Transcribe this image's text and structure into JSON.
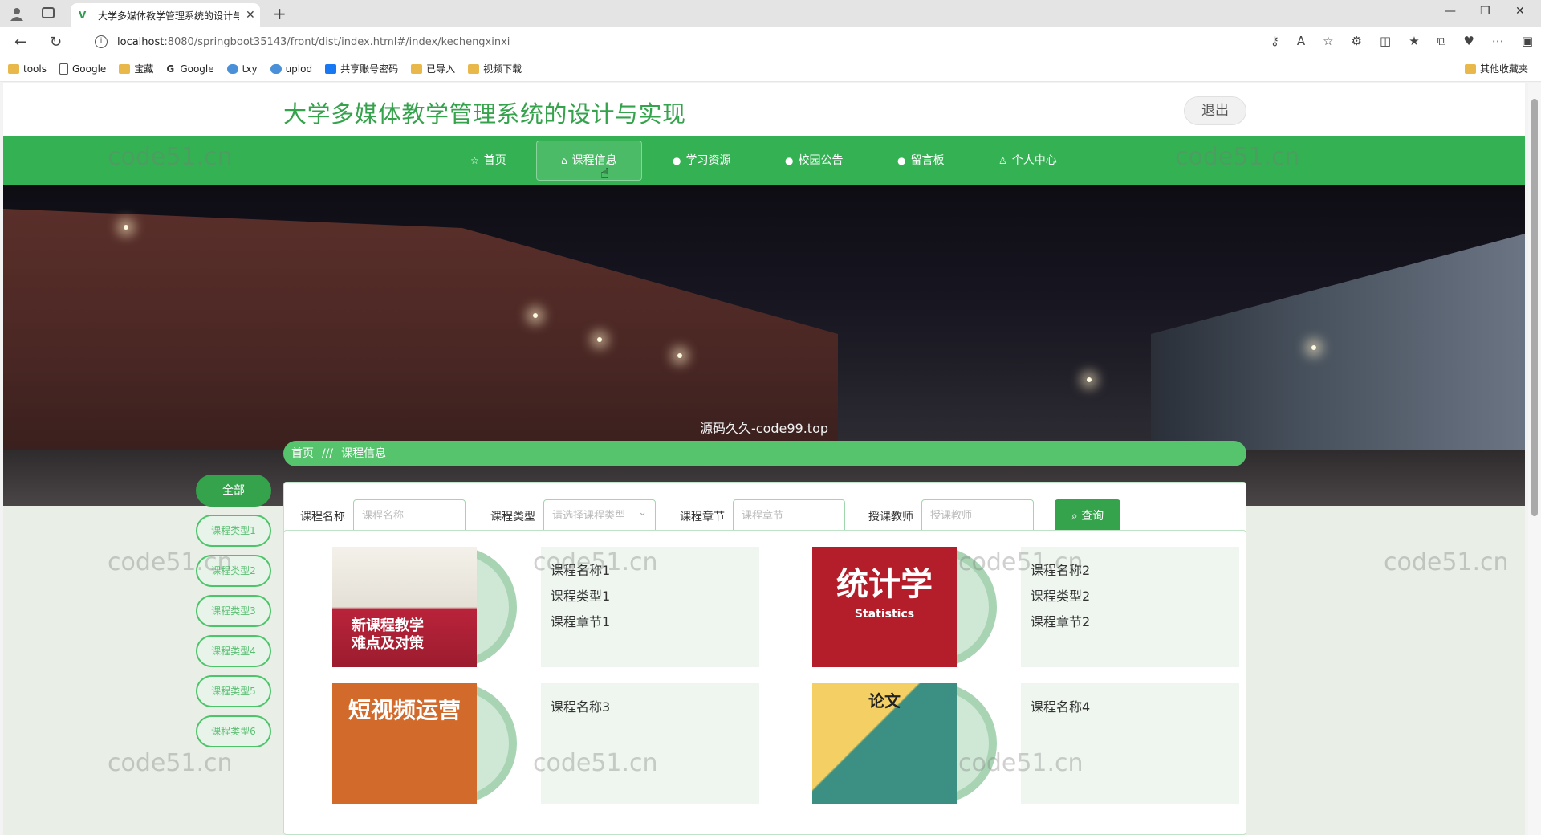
{
  "browser": {
    "tab_title": "大学多媒体教学管理系统的设计与...",
    "url_host": "localhost",
    "url_path": ":8080/springboot35143/front/dist/index.html#/index/kechengxinxi",
    "bookmarks": [
      "tools",
      "Google",
      "宝藏",
      "Google",
      "txy",
      "uplod",
      "共享账号密码",
      "已导入",
      "视频下载"
    ],
    "bookmark_right": "其他收藏夹"
  },
  "header": {
    "title": "大学多媒体教学管理系统的设计与实现",
    "logout": "退出"
  },
  "nav": {
    "items": [
      "首页",
      "课程信息",
      "学习资源",
      "校园公告",
      "留言板",
      "个人中心"
    ]
  },
  "banner": {
    "caption": "源码久久-code99.top"
  },
  "breadcrumb": {
    "home": "首页",
    "sep": "///",
    "current": "课程信息"
  },
  "sidebar": {
    "items": [
      "全部",
      "课程类型1",
      "课程类型2",
      "课程类型3",
      "课程类型4",
      "课程类型5",
      "课程类型6"
    ]
  },
  "search": {
    "fields": [
      {
        "label": "课程名称",
        "placeholder": "课程名称"
      },
      {
        "label": "课程类型",
        "placeholder": "请选择课程类型"
      },
      {
        "label": "课程章节",
        "placeholder": "课程章节"
      },
      {
        "label": "授课教师",
        "placeholder": "授课教师"
      }
    ],
    "button": "查询"
  },
  "courses": [
    {
      "name": "课程名称1",
      "type": "课程类型1",
      "chapter": "课程章节1",
      "cover_text": "新课程教学\n难点及对策"
    },
    {
      "name": "课程名称2",
      "type": "课程类型2",
      "chapter": "课程章节2",
      "cover_text": "统计学",
      "cover_sub": "Statistics"
    },
    {
      "name": "课程名称3",
      "cover_text": "短视频运营"
    },
    {
      "name": "课程名称4",
      "cover_text": "论文"
    }
  ],
  "watermark": "code51.cn"
}
